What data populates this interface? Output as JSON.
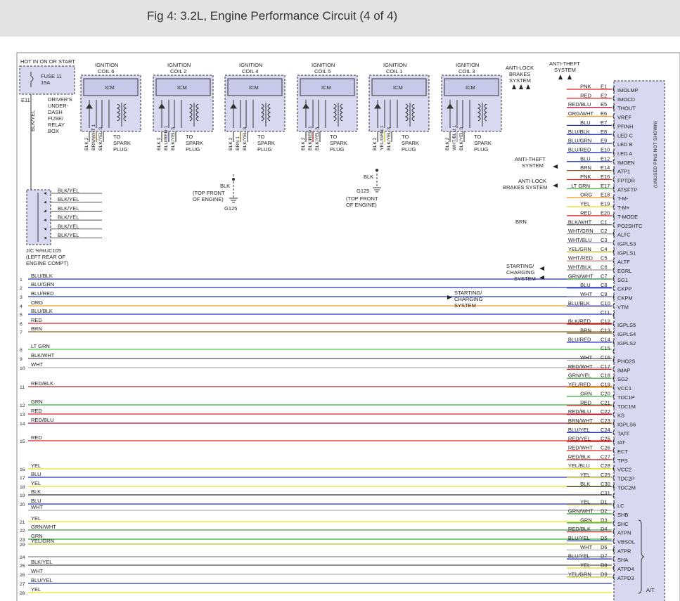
{
  "title": "Fig 4: 3.2L, Engine Performance Circuit (4 of 4)",
  "power": {
    "hot_label": "HOT IN ON OR START",
    "fuse_name": "FUSE 11",
    "fuse_amps": "15A",
    "fuse_terminal": "E11",
    "fuse_box_lines": [
      "DRIVER'S",
      "UNDER-",
      "DASH",
      "FUSE/",
      "RELAY",
      "BOX"
    ],
    "feed_wire": "BLK/YEL"
  },
  "coils": [
    {
      "line1": "IGNITION",
      "line2": "COIL 6",
      "icm": "ICM",
      "wires": [
        "BLK",
        "BRN/WHT",
        "BLK/YEL"
      ],
      "pins": [
        "2",
        "1",
        "3"
      ],
      "plug": [
        "TO",
        "SPARK",
        "PLUG"
      ]
    },
    {
      "line1": "IGNITION",
      "line2": "COIL 2",
      "icm": "ICM",
      "wires": [
        "BLK",
        "BLU/RED",
        "BLK/YEL"
      ],
      "pins": [
        "2",
        "1",
        "3"
      ],
      "plug": [
        "TO",
        "SPARK",
        "PLUG"
      ]
    },
    {
      "line1": "IGNITION",
      "line2": "COIL 4",
      "icm": "ICM",
      "wires": [
        "BLK",
        "BRN",
        "BLK/YEL"
      ],
      "pins": [
        "2",
        "1",
        "3"
      ],
      "plug": [
        "TO",
        "SPARK",
        "PLUG"
      ]
    },
    {
      "line1": "IGNITION",
      "line2": "COIL 5",
      "icm": "ICM",
      "wires": [
        "BLK",
        "BLK/RED",
        "BLK/YEL"
      ],
      "pins": [
        "2",
        "1",
        "3"
      ],
      "plug": [
        "TO",
        "SPARK",
        "PLUG"
      ]
    },
    {
      "line1": "IGNITION",
      "line2": "COIL 1",
      "icm": "ICM",
      "wires": [
        "BLK",
        "YEL/GRN",
        "BLK/YEL"
      ],
      "pins": [
        "2",
        "1",
        "3"
      ],
      "plug": [
        "TO",
        "SPARK",
        "PLUG"
      ]
    },
    {
      "line1": "IGNITION",
      "line2": "COIL 3",
      "icm": "ICM",
      "wires": [
        "BLK",
        "WHT/BLU",
        "BLK/YEL"
      ],
      "pins": [
        "2",
        "1",
        "3"
      ],
      "plug": [
        "TO",
        "SPARK",
        "PLUG"
      ]
    }
  ],
  "grounds": [
    {
      "wire": "BLK",
      "lines": [
        "(TOP FRONT",
        "OF ENGINE)"
      ],
      "name": "G125"
    },
    {
      "wire": "BLK",
      "lines": [
        "(TOP FRONT",
        "OF ENGINE)"
      ],
      "name": "G125"
    }
  ],
  "jc": {
    "lines": [
      "J/C %%UC105",
      "(LEFT REAR OF",
      "ENGINE COMPT)"
    ],
    "wires": [
      "BLK/YEL",
      "BLK/YEL",
      "BLK/YEL",
      "BLK/YEL",
      "BLK/YEL",
      "BLK/YEL"
    ]
  },
  "systems": {
    "antilock_top": [
      "ANTI-LOCK",
      "BRAKES",
      "SYSTEM"
    ],
    "antitheft_top": [
      "ANTI-THEFT",
      "SYSTEM"
    ],
    "antitheft_mid": [
      "ANTI-THEFT",
      "SYSTEM"
    ],
    "antilock_mid": [
      "ANTI-LOCK",
      "BRAKES SYSTEM"
    ],
    "starting_right": [
      "STARTING/",
      "CHARGING",
      "SYSTEM"
    ],
    "starting_left": [
      "STARTING/",
      "CHARGING",
      "SYSTEM"
    ]
  },
  "pcm": {
    "unused_note": "(UNUSED PINS NOT SHOWN)",
    "at_label": "A/T",
    "brn_label": "BRN"
  },
  "pcm_pins": [
    {
      "wire": "PNK",
      "pin": "E1",
      "name": "IMOLMP",
      "color": "#e02020"
    },
    {
      "wire": "RED",
      "pin": "E2",
      "name": "IMOCD",
      "color": "#e02020"
    },
    {
      "wire": "RED/BLU",
      "pin": "E5",
      "name": "THOUT",
      "color": "#c01040"
    },
    {
      "wire": "ORG/WHT",
      "pin": "E6",
      "name": "VREF",
      "color": "#f59a2a"
    },
    {
      "wire": "BLU",
      "pin": "E7",
      "name": "PFINH",
      "color": "#2030c0"
    },
    {
      "wire": "BLU/BLK",
      "pin": "E8",
      "name": "LED C",
      "color": "#2030c0"
    },
    {
      "wire": "BLU/GRN",
      "pin": "E9",
      "name": "LED B",
      "color": "#2030c0"
    },
    {
      "wire": "BLU/RED",
      "pin": "E10",
      "name": "LED A",
      "color": "#2030c0"
    },
    {
      "wire": "BLU",
      "pin": "E12",
      "name": "IMOEN",
      "color": "#2030c0"
    },
    {
      "wire": "BRN",
      "pin": "E14",
      "name": "ATP1",
      "color": "#8a6420"
    },
    {
      "wire": "PNK",
      "pin": "E16",
      "name": "FPTDR",
      "color": "#e02020"
    },
    {
      "wire": "LT GRN",
      "pin": "E17",
      "name": "ATSFTP",
      "color": "#40c040"
    },
    {
      "wire": "ORG",
      "pin": "E18",
      "name": "T-M-",
      "color": "#f59a2a"
    },
    {
      "wire": "YEL",
      "pin": "E19",
      "name": "T-M+",
      "color": "#e8e020"
    },
    {
      "wire": "RED",
      "pin": "E20",
      "name": "T-MODE",
      "color": "#e02020"
    },
    {
      "wire": "BLK/WHT",
      "pin": "C1",
      "name": "PO2SHTC",
      "color": "#555555"
    },
    {
      "wire": "WHT/GRN",
      "pin": "C2",
      "name": "ALTC",
      "color": "#909090"
    },
    {
      "wire": "WHT/BLU",
      "pin": "C3",
      "name": "IGPLS3",
      "color": "#9090c0"
    },
    {
      "wire": "YEL/GRN",
      "pin": "C4",
      "name": "IGPLS1",
      "color": "#c0c020"
    },
    {
      "wire": "WHT/RED",
      "pin": "C5",
      "name": "ALTF",
      "color": "#c08080"
    },
    {
      "wire": "WHT/BLK",
      "pin": "C6",
      "name": "EGRL",
      "color": "#909090"
    },
    {
      "wire": "GRN/WHT",
      "pin": "C7",
      "name": "SG1",
      "color": "#40a040"
    },
    {
      "wire": "BLU",
      "pin": "C8",
      "name": "CKPP",
      "color": "#2030c0"
    },
    {
      "wire": "WHT",
      "pin": "C9",
      "name": "CKPM",
      "color": "#b0b0b0"
    },
    {
      "wire": "BLU/BLK",
      "pin": "C10",
      "name": "VTM",
      "color": "#2030c0"
    },
    {
      "wire": "",
      "pin": "C11",
      "name": "",
      "color": "#888888"
    },
    {
      "wire": "BLK/RED",
      "pin": "C12",
      "name": "IGPLS5",
      "color": "#a02020"
    },
    {
      "wire": "BRN",
      "pin": "C13",
      "name": "IGPLS4",
      "color": "#8a6420"
    },
    {
      "wire": "BLU/RED",
      "pin": "C14",
      "name": "IGPLS2",
      "color": "#2030c0"
    },
    {
      "wire": "",
      "pin": "C15",
      "name": "",
      "color": "#888888"
    },
    {
      "wire": "WHT",
      "pin": "C16",
      "name": "PHO2S",
      "color": "#b0b0b0"
    },
    {
      "wire": "RED/WHT",
      "pin": "C17",
      "name": "IMAP",
      "color": "#e02020"
    },
    {
      "wire": "GRN/YEL",
      "pin": "C18",
      "name": "SG2",
      "color": "#40b040"
    },
    {
      "wire": "YEL/RED",
      "pin": "C19",
      "name": "VCC1",
      "color": "#e8c020"
    },
    {
      "wire": "GRN",
      "pin": "C20",
      "name": "TDC1P",
      "color": "#30b030"
    },
    {
      "wire": "RED",
      "pin": "C21",
      "name": "TDC1M",
      "color": "#e02020"
    },
    {
      "wire": "RED/BLU",
      "pin": "C22",
      "name": "KS",
      "color": "#c01040"
    },
    {
      "wire": "BRN/WHT",
      "pin": "C23",
      "name": "IGPLS6",
      "color": "#8a6420"
    },
    {
      "wire": "BLU/YEL",
      "pin": "C24",
      "name": "TATF",
      "color": "#2030c0"
    },
    {
      "wire": "RED/YEL",
      "pin": "C25",
      "name": "IAT",
      "color": "#e02020"
    },
    {
      "wire": "RED/WHT",
      "pin": "C26",
      "name": "ECT",
      "color": "#e02020"
    },
    {
      "wire": "RED/BLK",
      "pin": "C27",
      "name": "TPS",
      "color": "#c02020"
    },
    {
      "wire": "YEL/BLU",
      "pin": "C28",
      "name": "VCC2",
      "color": "#e8e020"
    },
    {
      "wire": "YEL",
      "pin": "C29",
      "name": "TDC2P",
      "color": "#e8e020"
    },
    {
      "wire": "BLK",
      "pin": "C30",
      "name": "TDC2M",
      "color": "#333333"
    },
    {
      "wire": "",
      "pin": "C31",
      "name": "",
      "color": "#888888"
    },
    {
      "wire": "YEL",
      "pin": "D1",
      "name": "LC",
      "color": "#e8e020"
    },
    {
      "wire": "GRN/WHT",
      "pin": "D2",
      "name": "SHB",
      "color": "#40a040"
    },
    {
      "wire": "GRN",
      "pin": "D3",
      "name": "SHC",
      "color": "#30b030"
    },
    {
      "wire": "RED/BLK",
      "pin": "D4",
      "name": "ATPN",
      "color": "#c02020"
    },
    {
      "wire": "BLU/YEL",
      "pin": "D5",
      "name": "VBSOL",
      "color": "#2030c0"
    },
    {
      "wire": "WHT",
      "pin": "D6",
      "name": "ATPR",
      "color": "#b0b0b0"
    },
    {
      "wire": "BLU/YEL",
      "pin": "D7",
      "name": "SHA",
      "color": "#2030c0"
    },
    {
      "wire": "YEL",
      "pin": "D8",
      "name": "ATPD4",
      "color": "#e8e020"
    },
    {
      "wire": "YEL/GRN",
      "pin": "D9",
      "name": "ATPD3",
      "color": "#c0c020"
    }
  ],
  "connector_rows": [
    {
      "num": "1",
      "wire": "BLU/BLK",
      "color": "#2030c0"
    },
    {
      "num": "2",
      "wire": "BLU/GRN",
      "color": "#2030c0"
    },
    {
      "num": "3",
      "wire": "BLU/RED",
      "color": "#2030c0"
    },
    {
      "num": "4",
      "wire": "ORG",
      "color": "#f59a2a"
    },
    {
      "num": "5",
      "wire": "BLU/BLK",
      "color": "#2030c0"
    },
    {
      "num": "6",
      "wire": "RED",
      "color": "#e02020"
    },
    {
      "num": "7",
      "wire": "BRN",
      "color": "#8a6420"
    },
    {
      "num": "8",
      "wire": "LT GRN",
      "color": "#40d040"
    },
    {
      "num": "9",
      "wire": "BLK/WHT",
      "color": "#555555"
    },
    {
      "num": "10",
      "wire": "WHT",
      "color": "#b0b0b0"
    },
    {
      "num": "11",
      "wire": "RED/BLK",
      "color": "#c02020"
    },
    {
      "num": "12",
      "wire": "GRN",
      "color": "#30b030"
    },
    {
      "num": "13",
      "wire": "RED",
      "color": "#e02020"
    },
    {
      "num": "14",
      "wire": "RED/BLU",
      "color": "#c01040"
    },
    {
      "num": "15",
      "wire": "RED",
      "color": "#e02020"
    },
    {
      "num": "16",
      "wire": "YEL",
      "color": "#e8e020"
    },
    {
      "num": "17",
      "wire": "BLU",
      "color": "#2030c0"
    },
    {
      "num": "18",
      "wire": "YEL",
      "color": "#e8e020"
    },
    {
      "num": "19",
      "wire": "BLK",
      "color": "#333333"
    },
    {
      "num": "20",
      "wire": "BLU",
      "color": "#2030c0"
    },
    {
      "num": "",
      "wire": "WHT",
      "color": "#b0b0b0"
    },
    {
      "num": "21",
      "wire": "YEL",
      "color": "#e8e020"
    },
    {
      "num": "22",
      "wire": "GRN/WHT",
      "color": "#40a040"
    },
    {
      "num": "23",
      "wire": "GRN",
      "color": "#30b030"
    },
    {
      "num": "24",
      "wire": "",
      "color": "#888888"
    },
    {
      "num": "25",
      "wire": "BLK/YEL",
      "color": "#555555"
    },
    {
      "num": "26",
      "wire": "WHT",
      "color": "#b0b0b0"
    },
    {
      "num": "27",
      "wire": "BLU/YEL",
      "color": "#2030c0"
    },
    {
      "num": "28",
      "wire": "YEL",
      "color": "#e8e020"
    },
    {
      "num": "29",
      "wire": "YEL/GRN",
      "color": "#c0c020"
    }
  ]
}
